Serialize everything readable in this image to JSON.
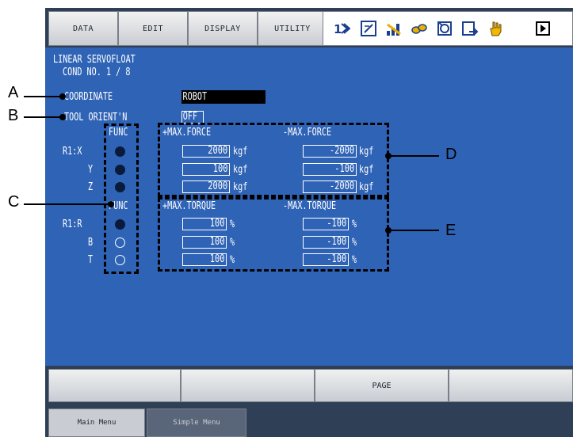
{
  "menu": [
    "DATA",
    "EDIT",
    "DISPLAY",
    "UTILITY"
  ],
  "status_icons": [
    "mode-icon",
    "edit-icon",
    "signal-icon",
    "speed-icon",
    "cycle-icon",
    "export-icon",
    "hand-icon",
    "play-icon"
  ],
  "screen": {
    "title": "LINEAR SERVOFLOAT",
    "cond": "COND NO. 1 / 8",
    "coordinate_label": "COORDINATE",
    "coordinate_value": "ROBOT",
    "tool_label": "TOOL ORIENT'N",
    "tool_value": "OFF",
    "func_label": "FUNC",
    "force": {
      "pos_header": "+MAX.FORCE",
      "neg_header": "-MAX.FORCE",
      "unit": "kgf",
      "rows": [
        {
          "axis": "R1:X",
          "on": true,
          "pos": "2000",
          "neg": "-2000"
        },
        {
          "axis": "Y",
          "on": true,
          "pos": "100",
          "neg": "-100"
        },
        {
          "axis": "Z",
          "on": true,
          "pos": "2000",
          "neg": "-2000"
        }
      ]
    },
    "torque": {
      "pos_header": "+MAX.TORQUE",
      "neg_header": "-MAX.TORQUE",
      "unit": "%",
      "rows": [
        {
          "axis": "R1:R",
          "on": true,
          "pos": "100",
          "neg": "-100"
        },
        {
          "axis": "B",
          "on": false,
          "pos": "100",
          "neg": "-100"
        },
        {
          "axis": "T",
          "on": false,
          "pos": "100",
          "neg": "-100"
        }
      ]
    }
  },
  "fkeys": [
    "",
    "",
    "PAGE",
    ""
  ],
  "tabs": {
    "main_menu": "Main Menu",
    "simple_menu": "Simple Menu"
  },
  "callouts": {
    "a": "A",
    "b": "B",
    "c": "C",
    "d": "D",
    "e": "E"
  },
  "colors": {
    "screen_bg": "#2f63b5",
    "frame": "#2f3f56",
    "accent_field": "#000000"
  }
}
